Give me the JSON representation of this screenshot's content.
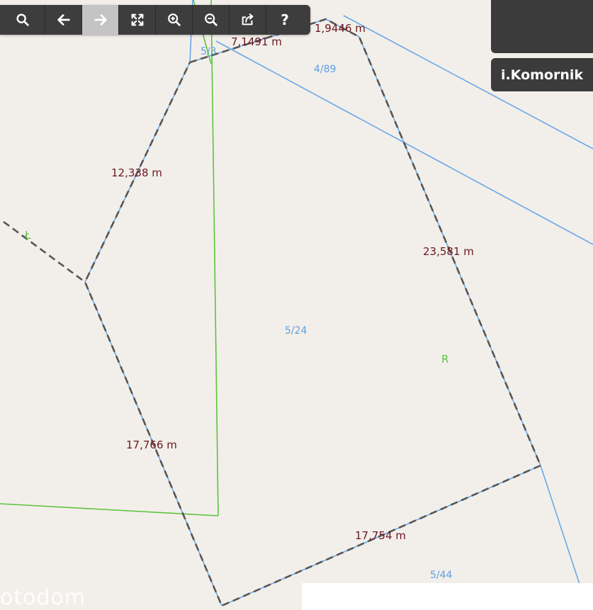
{
  "toolbar": {
    "tools": [
      {
        "icon": "search-icon",
        "active": false
      },
      {
        "icon": "arrow-left-icon",
        "active": false
      },
      {
        "icon": "arrow-right-icon",
        "active": true
      },
      {
        "icon": "fullscreen-icon",
        "active": false
      },
      {
        "icon": "zoom-in-icon",
        "active": false
      },
      {
        "icon": "zoom-out-icon",
        "active": false
      },
      {
        "icon": "share-icon",
        "active": false
      },
      {
        "icon": "help-icon",
        "label": "?",
        "active": false
      }
    ]
  },
  "brand": {
    "label": "i.Komornik"
  },
  "watermark": "otodom",
  "map": {
    "measurements": [
      "7,1491 m",
      "1,9446 m",
      "12,338 m",
      "23,581 m",
      "17,766 m",
      "17,754 m"
    ],
    "parcels": [
      "5/3",
      "4/89",
      "5/24",
      "5/44"
    ],
    "landuse": [
      "Ł",
      "R"
    ]
  },
  "colors": {
    "background": "#f2efea",
    "parcel_line": "#6aa8e8",
    "landuse_line": "#5dc241",
    "boundary_dash": "#555555",
    "measurement_text": "#6b1620",
    "toolbar": "#3d3d3d"
  }
}
